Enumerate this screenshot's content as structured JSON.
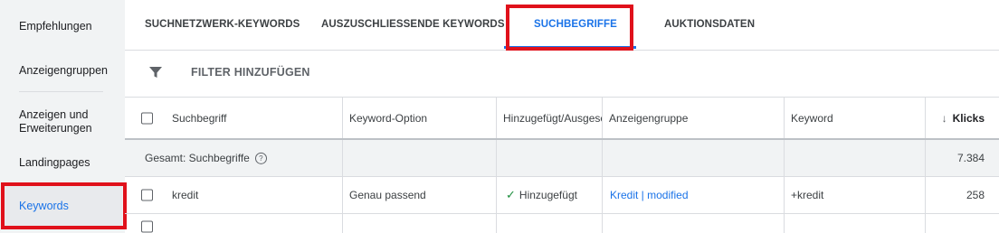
{
  "sidebar": {
    "items": [
      "Empfehlungen",
      "Anzeigengruppen",
      "Anzeigen und\nErweiterungen",
      "Landingpages"
    ],
    "active": "Keywords"
  },
  "tabs": {
    "items": [
      "SUCHNETZWERK-KEYWORDS",
      "AUSZUSCHLIESSENDE KEYWORDS",
      "SUCHBEGRIFFE",
      "AUKTIONSDATEN"
    ],
    "active": "SUCHBEGRIFFE"
  },
  "filter": {
    "label": "FILTER HINZUFÜGEN",
    "icon": "filter-icon"
  },
  "table": {
    "columns": [
      "Suchbegriff",
      "Keyword-Option",
      "Hinzugefügt/Ausgeschlossen",
      "Anzeigengruppe",
      "Keyword",
      "Klicks"
    ],
    "sort_icon": "arrow-down-icon",
    "total": {
      "label": "Gesamt: Suchbegriffe",
      "help_icon": "help-icon",
      "klicks": "7.384"
    },
    "rows": [
      {
        "suchbegriff": "kredit",
        "keyword_option": "Genau passend",
        "status": "Hinzugefügt",
        "anzeigengruppe": "Kredit | modified",
        "keyword": "+kredit",
        "klicks": "258"
      }
    ]
  },
  "colors": {
    "accent": "#1a73e8",
    "highlight": "#e0111b",
    "success": "#1e8e3e"
  }
}
